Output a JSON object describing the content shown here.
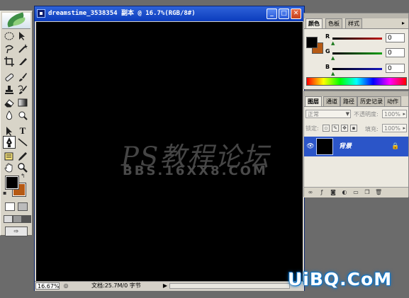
{
  "document": {
    "title": "dreamstime_3538354 副本 @ 16.7%(RGB/8#)",
    "zoom": "16.67%",
    "doc_info": "文档:25.7M/0 字节",
    "watermark_line1": "PS教程论坛",
    "watermark_line2": "BBS.16XX8.COM"
  },
  "tools": {
    "foreground_color": "#000000",
    "background_color": "#b65a14",
    "icons": [
      "marquee-icon",
      "move-icon",
      "lasso-icon",
      "magic-wand-icon",
      "crop-icon",
      "slice-icon",
      "healing-brush-icon",
      "brush-icon",
      "clone-stamp-icon",
      "history-brush-icon",
      "eraser-icon",
      "gradient-icon",
      "blur-icon",
      "dodge-icon",
      "path-select-icon",
      "type-icon",
      "pen-icon",
      "line-icon",
      "notes-icon",
      "eyedropper-icon",
      "hand-icon",
      "zoom-icon"
    ]
  },
  "color_palette": {
    "tabs": [
      "颜色",
      "色板",
      "样式"
    ],
    "channels": [
      {
        "label": "R",
        "value": "0",
        "color": "#c01818"
      },
      {
        "label": "G",
        "value": "0",
        "color": "#18a018"
      },
      {
        "label": "B",
        "value": "0",
        "color": "#1818c0"
      }
    ]
  },
  "layers_palette": {
    "tabs": [
      "图层",
      "通道",
      "路径",
      "历史记录",
      "动作"
    ],
    "blend_mode": "正常",
    "opacity_label": "不透明度:",
    "opacity_value": "100%",
    "lock_label": "锁定:",
    "fill_label": "填充:",
    "fill_value": "100%",
    "layer_name": "背景"
  },
  "site_watermark": "UiBQ.CoM"
}
